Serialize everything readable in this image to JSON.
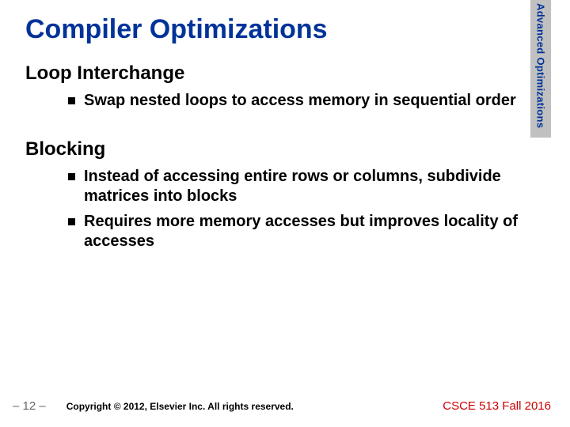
{
  "title": "Compiler Optimizations",
  "side_tab": "Advanced Optimizations",
  "sections": {
    "s1": {
      "heading": "Loop Interchange",
      "items": {
        "i1": "Swap nested loops to access memory in sequential order"
      }
    },
    "s2": {
      "heading": "Blocking",
      "items": {
        "i1": "Instead of accessing entire rows or columns, subdivide matrices into blocks",
        "i2": "Requires more memory accesses but improves locality of accesses"
      }
    }
  },
  "footer": {
    "page": "– 12 –",
    "copyright": "Copyright © 2012, Elsevier Inc. All rights reserved.",
    "course": "CSCE 513 Fall 2016"
  }
}
